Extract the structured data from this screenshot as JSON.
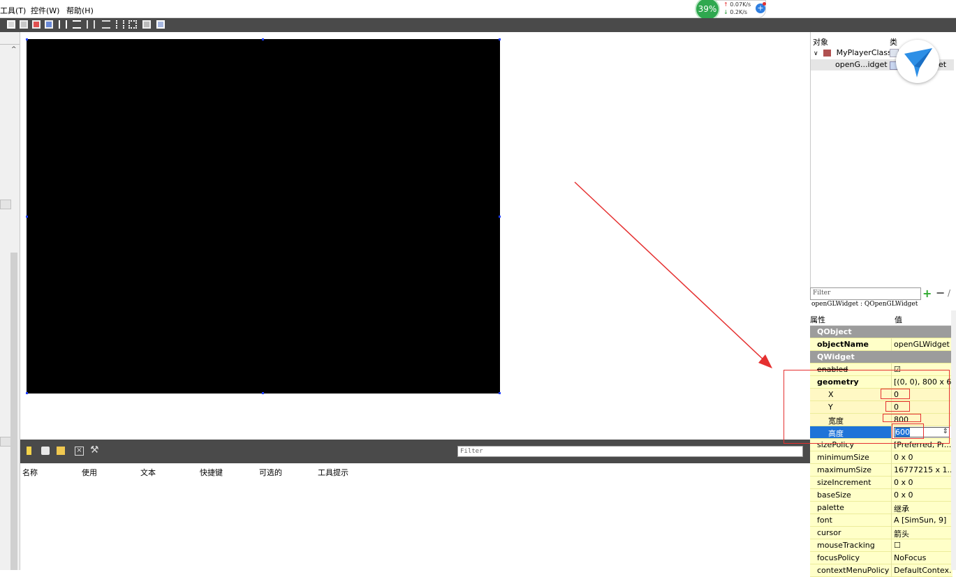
{
  "menu": {
    "tools": "工具(T)",
    "widgets": "控件(W)",
    "help": "帮助(H)"
  },
  "net_widget": {
    "cpu_percent": "39%",
    "upload": "0.07K/s",
    "download": "0.2K/s"
  },
  "object_inspector": {
    "col_object": "对象",
    "col_class": "类",
    "root_name": "MyPlayerClass",
    "child_name": "openG...idget",
    "child_class_tail": "et"
  },
  "property_editor": {
    "filter_placeholder": "Filter",
    "class_line": "openGLWidget : QOpenGLWidget",
    "col_property": "属性",
    "col_value": "值",
    "rows": [
      {
        "name": "QObject",
        "value": "",
        "kind": "group"
      },
      {
        "name": "objectName",
        "value": "openGLWidget",
        "kind": "bold"
      },
      {
        "name": "QWidget",
        "value": "",
        "kind": "group"
      },
      {
        "name": "enabled",
        "value": "☑",
        "kind": "normal"
      },
      {
        "name": "geometry",
        "value": "[(0, 0), 800 x 6...",
        "kind": "bold"
      },
      {
        "name": "X",
        "value": "0",
        "kind": "sub"
      },
      {
        "name": "Y",
        "value": "0",
        "kind": "sub"
      },
      {
        "name": "宽度",
        "value": "800",
        "kind": "sub"
      },
      {
        "name": "高度",
        "value": "600",
        "kind": "selected"
      },
      {
        "name": "sizePolicy",
        "value": "[Preferred, Pr...",
        "kind": "normal"
      },
      {
        "name": "minimumSize",
        "value": "0 x 0",
        "kind": "normal"
      },
      {
        "name": "maximumSize",
        "value": "16777215 x 1...",
        "kind": "normal"
      },
      {
        "name": "sizeIncrement",
        "value": "0 x 0",
        "kind": "normal"
      },
      {
        "name": "baseSize",
        "value": "0 x 0",
        "kind": "normal"
      },
      {
        "name": "palette",
        "value": "继承",
        "kind": "normal"
      },
      {
        "name": "font",
        "value": "A  [SimSun, 9]",
        "kind": "normal"
      },
      {
        "name": "cursor",
        "value": "箭头",
        "kind": "normal"
      },
      {
        "name": "mouseTracking",
        "value": "☐",
        "kind": "normal"
      },
      {
        "name": "focusPolicy",
        "value": "NoFocus",
        "kind": "normal"
      },
      {
        "name": "contextMenuPolicy",
        "value": "DefaultContex...",
        "kind": "normal"
      }
    ]
  },
  "action_editor": {
    "filter_placeholder": "Filter",
    "columns": [
      "名称",
      "使用",
      "文本",
      "快捷键",
      "可选的",
      "工具提示"
    ]
  },
  "colors": {
    "toolbar_bg": "#4a4a4a",
    "property_row_bg": "#ffffc8",
    "group_bg": "#9c9c9c",
    "selection_blue": "#1e73d8",
    "annotation_red": "#e53030"
  }
}
